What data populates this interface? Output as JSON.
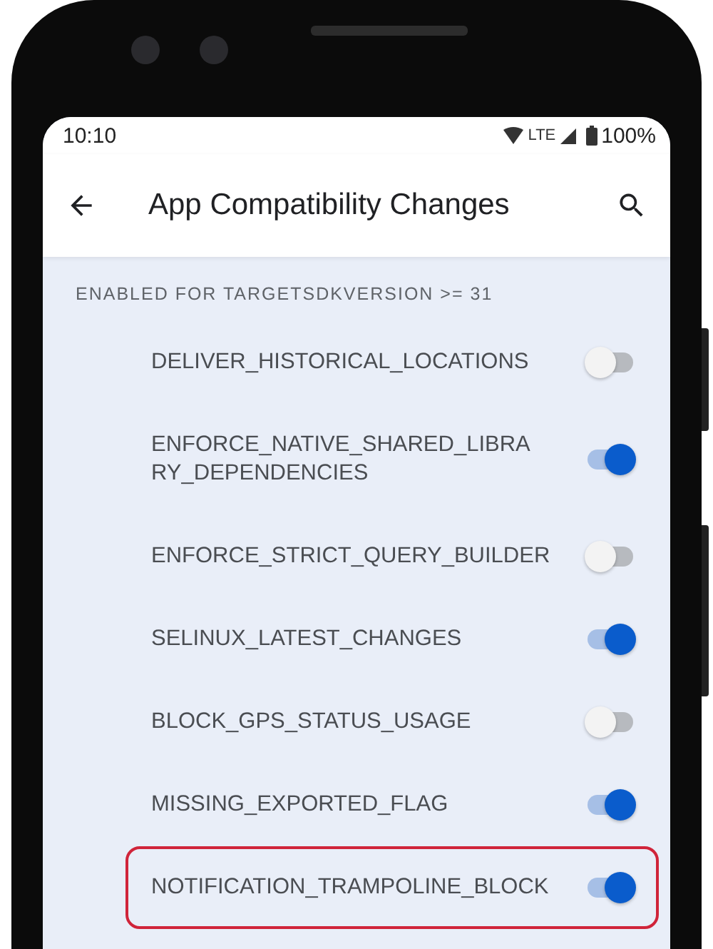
{
  "status_bar": {
    "time": "10:10",
    "network": "LTE",
    "battery": "100%"
  },
  "app_bar": {
    "title": "App Compatibility Changes"
  },
  "section": {
    "header": "ENABLED FOR TARGETSDKVERSION >= 31"
  },
  "changes": [
    {
      "name": "DELIVER_HISTORICAL_LOCATIONS",
      "on": false,
      "highlighted": false
    },
    {
      "name": "ENFORCE_NATIVE_SHARED_LIBRA\nRY_DEPENDENCIES",
      "on": true,
      "highlighted": false
    },
    {
      "name": "ENFORCE_STRICT_QUERY_BUILDER",
      "on": false,
      "highlighted": false
    },
    {
      "name": "SELINUX_LATEST_CHANGES",
      "on": true,
      "highlighted": false
    },
    {
      "name": "BLOCK_GPS_STATUS_USAGE",
      "on": false,
      "highlighted": false
    },
    {
      "name": "MISSING_EXPORTED_FLAG",
      "on": true,
      "highlighted": false
    },
    {
      "name": "NOTIFICATION_TRAMPOLINE_BLOCK",
      "on": true,
      "highlighted": true
    }
  ]
}
